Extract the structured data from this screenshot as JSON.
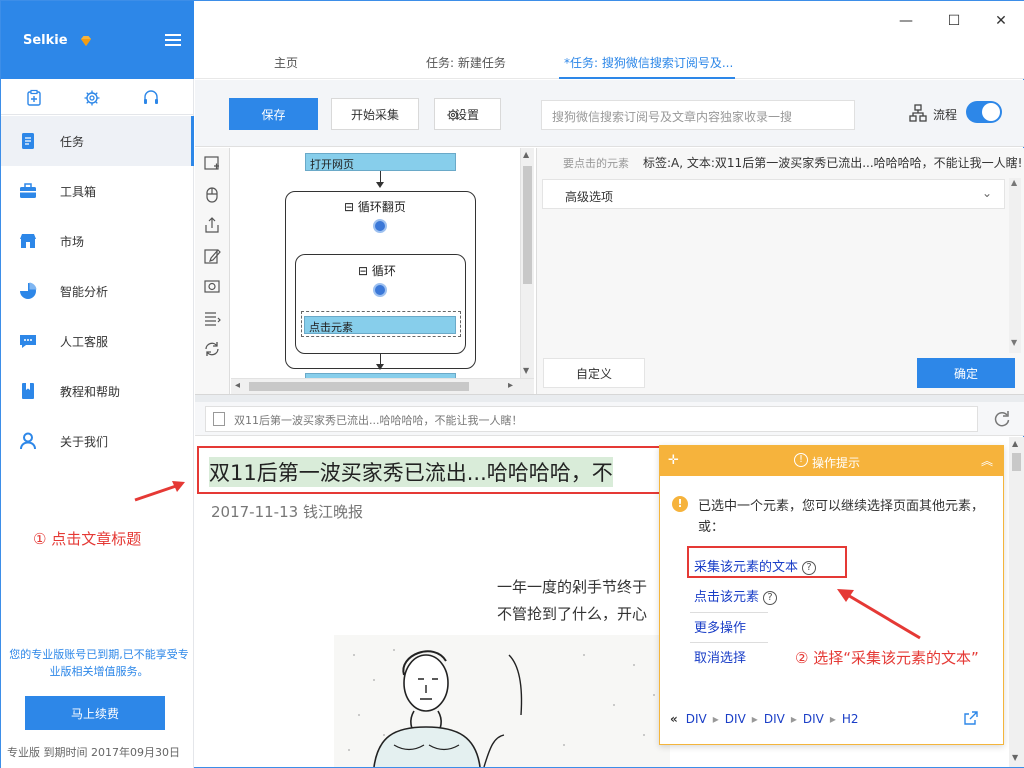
{
  "sidebar": {
    "brand": "Selkie",
    "quick_icons": [
      "clipboard-add-icon",
      "gear-icon",
      "headset-icon"
    ],
    "items": [
      {
        "label": "任务",
        "icon": "document-icon"
      },
      {
        "label": "工具箱",
        "icon": "toolbox-icon"
      },
      {
        "label": "市场",
        "icon": "store-icon"
      },
      {
        "label": "智能分析",
        "icon": "pie-chart-icon"
      },
      {
        "label": "人工客服",
        "icon": "chat-icon"
      },
      {
        "label": "教程和帮助",
        "icon": "book-icon"
      },
      {
        "label": "关于我们",
        "icon": "user-icon"
      }
    ],
    "notice": "您的专业版账号已到期,已不能享受专业版相关增值服务。",
    "renew_label": "马上续费",
    "version_text": "专业版  到期时间  2017年09月30日"
  },
  "window": {
    "minimize": "—",
    "maximize": "☐",
    "close": "✕"
  },
  "tabs": [
    {
      "label": "主页"
    },
    {
      "label": "任务: 新建任务"
    },
    {
      "label": "*任务: 搜狗微信搜索订阅号及..."
    }
  ],
  "toolbar": {
    "save_label": "保存",
    "start_label": "开始采集",
    "settings_label": "设置",
    "search_placeholder": "搜狗微信搜索订阅号及文章内容独家收录一搜",
    "flow_label": "流程",
    "flow_toggle_on": true
  },
  "workflow": {
    "nodes": {
      "open_page": "打开网页",
      "loop_paging": "循环翻页",
      "loop": "循环",
      "click_element": "点击元素"
    }
  },
  "properties": {
    "hint_label": "要点击的元素",
    "hint_value": "标签:A, 文本:双11后第一波买家秀已流出...哈哈哈哈，不能让我一人瞎!",
    "advanced_label": "高级选项",
    "custom_label": "自定义",
    "ok_label": "确定"
  },
  "browser": {
    "url_text": "双11后第一波买家秀已流出...哈哈哈哈，不能让我一人瞎！"
  },
  "article": {
    "title": "双11后第一波买家秀已流出...哈哈哈哈，不",
    "meta": "2017-11-13  钱江晚报",
    "para1": "一年一度的剁手节终于",
    "para2": "不管抢到了什么，开心"
  },
  "annotations": {
    "step1": "① 点击文章标题",
    "step2": "② 选择“采集该元素的文本”",
    "color": "#e53935"
  },
  "tips": {
    "title": "操作提示",
    "message": "已选中一个元素，您可以继续选择页面其他元素，或：",
    "options": [
      "采集该元素的文本",
      "点击该元素",
      "更多操作",
      "取消选择"
    ],
    "crumbs": [
      "DIV",
      "DIV",
      "DIV",
      "DIV",
      "H2"
    ]
  },
  "colors": {
    "accent": "#2d87e8",
    "tips_header": "#f6b33c",
    "node_fill": "#87ceeb"
  }
}
